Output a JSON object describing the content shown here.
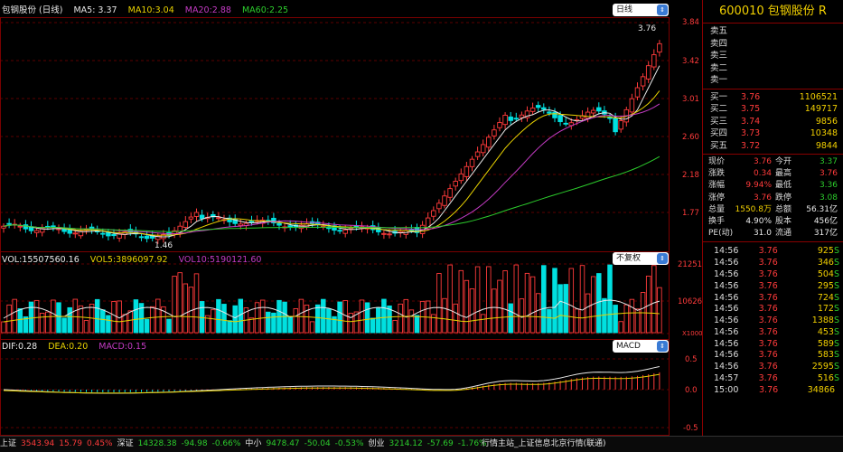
{
  "chart": {
    "title": "包钢股份 (日线)",
    "ma": [
      {
        "label": "MA5: 3.37",
        "color": "#e8e8e8"
      },
      {
        "label": "MA10:3.04",
        "color": "#e8d200"
      },
      {
        "label": "MA20:2.88",
        "color": "#c43bc4"
      },
      {
        "label": "MA60:2.25",
        "color": "#2ccc2c"
      }
    ],
    "period_select": "日线",
    "high_label": "3.76",
    "low_label": "1.46",
    "price_axis": [
      "3.84",
      "3.42",
      "3.01",
      "2.60",
      "2.18",
      "1.77"
    ],
    "vol": {
      "labels": [
        {
          "label": "VOL:15507560.16",
          "color": "#e8e8e8"
        },
        {
          "label": "VOL5:3896097.92",
          "color": "#e8d200"
        },
        {
          "label": "VOL10:5190121.60",
          "color": "#c43bc4"
        }
      ],
      "select": "不复权",
      "axis": [
        "21251",
        "10626"
      ],
      "unit": "X1000"
    },
    "macd": {
      "labels": [
        {
          "label": "DIF:0.28",
          "color": "#e8e8e8"
        },
        {
          "label": "DEA:0.20",
          "color": "#e8d200"
        },
        {
          "label": "MACD:0.15",
          "color": "#c43bc4"
        }
      ],
      "select": "MACD",
      "axis": [
        "0.5",
        "0.0",
        "-0.5"
      ]
    }
  },
  "quote": {
    "title": "600010 包钢股份 R",
    "sell": [
      {
        "label": "卖五",
        "price": "",
        "vol": ""
      },
      {
        "label": "卖四",
        "price": "",
        "vol": ""
      },
      {
        "label": "卖三",
        "price": "",
        "vol": ""
      },
      {
        "label": "卖二",
        "price": "",
        "vol": ""
      },
      {
        "label": "卖一",
        "price": "",
        "vol": ""
      }
    ],
    "buy": [
      {
        "label": "买一",
        "price": "3.76",
        "vol": "1106521"
      },
      {
        "label": "买二",
        "price": "3.75",
        "vol": "149717"
      },
      {
        "label": "买三",
        "price": "3.74",
        "vol": "9856"
      },
      {
        "label": "买四",
        "price": "3.73",
        "vol": "10348"
      },
      {
        "label": "买五",
        "price": "3.72",
        "vol": "9844"
      }
    ],
    "stats": [
      {
        "l1": "现价",
        "v1": "3.76",
        "c1": "#ff3b3b",
        "l2": "今开",
        "v2": "3.37",
        "c2": "#2ccc2c"
      },
      {
        "l1": "涨跌",
        "v1": "0.34",
        "c1": "#ff3b3b",
        "l2": "最高",
        "v2": "3.76",
        "c2": "#ff3b3b"
      },
      {
        "l1": "涨幅",
        "v1": "9.94%",
        "c1": "#ff3b3b",
        "l2": "最低",
        "v2": "3.36",
        "c2": "#2ccc2c"
      },
      {
        "l1": "涨停",
        "v1": "3.76",
        "c1": "#ff3b3b",
        "l2": "跌停",
        "v2": "3.08",
        "c2": "#2ccc2c"
      },
      {
        "l1": "总量",
        "v1": "1550.8万",
        "c1": "#f2d000",
        "l2": "总额",
        "v2": "56.31亿",
        "c2": "#e8e8e8"
      },
      {
        "l1": "换手",
        "v1": "4.90%",
        "c1": "#e8e8e8",
        "l2": "股本",
        "v2": "456亿",
        "c2": "#e8e8e8"
      },
      {
        "l1": "PE(动)",
        "v1": "31.0",
        "c1": "#e8e8e8",
        "l2": "流通",
        "v2": "317亿",
        "c2": "#e8e8e8"
      }
    ],
    "ticks": [
      {
        "time": "14:56",
        "price": "3.76",
        "vol": "925",
        "side": "S"
      },
      {
        "time": "14:56",
        "price": "3.76",
        "vol": "346",
        "side": "S"
      },
      {
        "time": "14:56",
        "price": "3.76",
        "vol": "504",
        "side": "S"
      },
      {
        "time": "14:56",
        "price": "3.76",
        "vol": "295",
        "side": "S"
      },
      {
        "time": "14:56",
        "price": "3.76",
        "vol": "724",
        "side": "S"
      },
      {
        "time": "14:56",
        "price": "3.76",
        "vol": "172",
        "side": "S"
      },
      {
        "time": "14:56",
        "price": "3.76",
        "vol": "1388",
        "side": "S"
      },
      {
        "time": "14:56",
        "price": "3.76",
        "vol": "453",
        "side": "S"
      },
      {
        "time": "14:56",
        "price": "3.76",
        "vol": "589",
        "side": "S"
      },
      {
        "time": "14:56",
        "price": "3.76",
        "vol": "583",
        "side": "S"
      },
      {
        "time": "14:56",
        "price": "3.76",
        "vol": "2595",
        "side": "S"
      },
      {
        "time": "14:57",
        "price": "3.76",
        "vol": "516",
        "side": "S"
      },
      {
        "time": "15:00",
        "price": "3.76",
        "vol": "34866",
        "side": ""
      }
    ]
  },
  "status": {
    "items": [
      {
        "name": "上证",
        "idx": "3543.94",
        "chg": "15.79",
        "pct": "0.45%",
        "color": "#ff3b3b"
      },
      {
        "name": "深证",
        "idx": "14328.38",
        "chg": "-94.98",
        "pct": "-0.66%",
        "color": "#2ccc2c"
      },
      {
        "name": "中小",
        "idx": "9478.47",
        "chg": "-50.04",
        "pct": "-0.53%",
        "color": "#2ccc2c"
      },
      {
        "name": "创业",
        "idx": "3214.12",
        "chg": "-57.69",
        "pct": "-1.76%",
        "color": "#2ccc2c"
      }
    ],
    "server": "行情主站_上证信息北京行情(联通)"
  },
  "colors": {
    "up": "#ff3b3b",
    "down": "#00e0e0",
    "ma5": "#e8e8e8",
    "ma10": "#e8d200",
    "ma20": "#c43bc4",
    "ma60": "#2ccc2c",
    "grid": "#7a0000"
  }
}
